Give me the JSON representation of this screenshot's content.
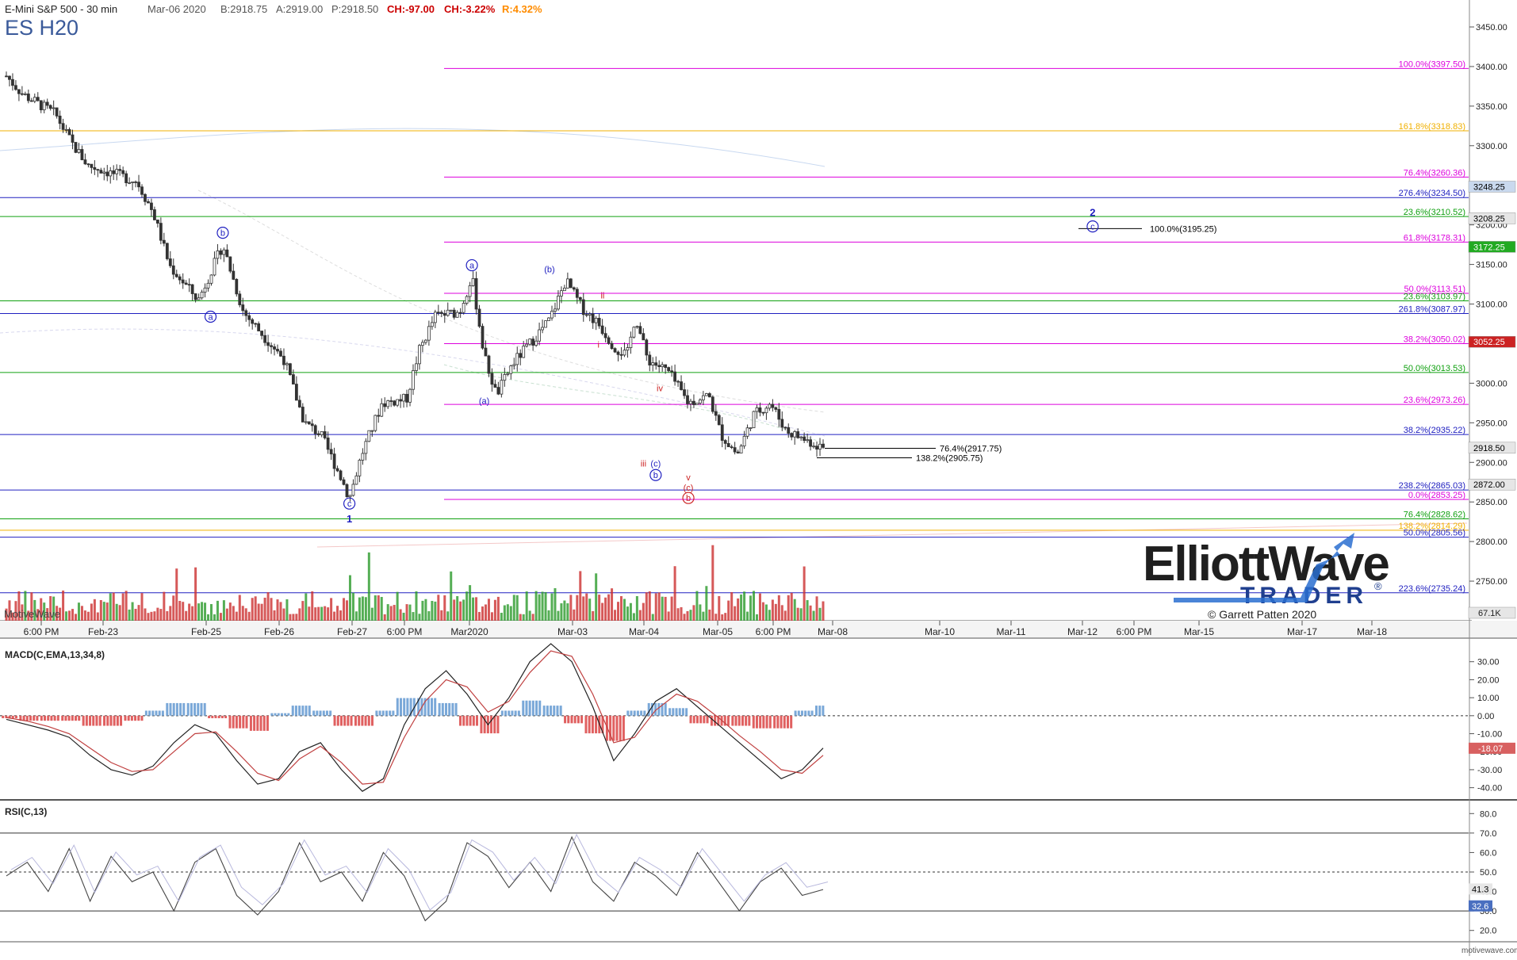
{
  "header": {
    "instrument": "E-Mini S&P 500 - 30 min",
    "date": "Mar-06 2020",
    "bid": "B:2918.75",
    "ask": "A:2919.00",
    "price": "P:2918.50",
    "change": "CH:-97.00",
    "change_pct": "CH:-3.22%",
    "range_pct": "R:4.32%",
    "symbol": "ES H20",
    "colors": {
      "negative": "#cc0000",
      "range": "#ff8c00",
      "symbol": "#3a5a9a"
    }
  },
  "chart_data": [
    {
      "type": "candlestick",
      "panel": "price",
      "ylim": [
        2700,
        3460
      ],
      "y_ticks": [
        "3450.00",
        "3400.00",
        "3350.00",
        "3300.00",
        "3250.00",
        "3200.00",
        "3150.00",
        "3100.00",
        "3050.00",
        "3000.00",
        "2950.00",
        "2900.00",
        "2850.00",
        "2800.00",
        "2750.00"
      ],
      "x_ticks": [
        "6:00 PM",
        "Feb-23",
        "Feb-25",
        "Feb-26",
        "Feb-27",
        "6:00 PM",
        "Mar2020",
        "Mar-03",
        "Mar-04",
        "Mar-05",
        "6:00 PM",
        "Mar-08",
        "Mar-10",
        "Mar-11",
        "Mar-12",
        "6:00 PM",
        "Mar-15",
        "Mar-17",
        "Mar-18"
      ],
      "price_path": [
        {
          "t": 0,
          "v": 3388
        },
        {
          "t": 0.02,
          "v": 3365
        },
        {
          "t": 0.06,
          "v": 3340
        },
        {
          "t": 0.08,
          "v": 3303
        },
        {
          "t": 0.1,
          "v": 3275
        },
        {
          "t": 0.13,
          "v": 3265
        },
        {
          "t": 0.16,
          "v": 3255
        },
        {
          "t": 0.18,
          "v": 3215
        },
        {
          "t": 0.2,
          "v": 3148
        },
        {
          "t": 0.235,
          "v": 3105
        },
        {
          "t": 0.25,
          "v": 3140
        },
        {
          "t": 0.265,
          "v": 3175
        },
        {
          "t": 0.29,
          "v": 3090
        },
        {
          "t": 0.315,
          "v": 3060
        },
        {
          "t": 0.34,
          "v": 3030
        },
        {
          "t": 0.365,
          "v": 2950
        },
        {
          "t": 0.385,
          "v": 2935
        },
        {
          "t": 0.41,
          "v": 2880
        },
        {
          "t": 0.42,
          "v": 2855
        },
        {
          "t": 0.435,
          "v": 2910
        },
        {
          "t": 0.46,
          "v": 2975
        },
        {
          "t": 0.49,
          "v": 2980
        },
        {
          "t": 0.505,
          "v": 3040
        },
        {
          "t": 0.525,
          "v": 3085
        },
        {
          "t": 0.555,
          "v": 3090
        },
        {
          "t": 0.57,
          "v": 3135
        },
        {
          "t": 0.585,
          "v": 3035
        },
        {
          "t": 0.6,
          "v": 2985
        },
        {
          "t": 0.62,
          "v": 3025
        },
        {
          "t": 0.645,
          "v": 3055
        },
        {
          "t": 0.665,
          "v": 3080
        },
        {
          "t": 0.685,
          "v": 3130
        },
        {
          "t": 0.705,
          "v": 3095
        },
        {
          "t": 0.725,
          "v": 3075
        },
        {
          "t": 0.745,
          "v": 3045
        },
        {
          "t": 0.76,
          "v": 3035
        },
        {
          "t": 0.77,
          "v": 3085
        },
        {
          "t": 0.785,
          "v": 3030
        },
        {
          "t": 0.81,
          "v": 3015
        },
        {
          "t": 0.835,
          "v": 2975
        },
        {
          "t": 0.86,
          "v": 2985
        },
        {
          "t": 0.875,
          "v": 2935
        },
        {
          "t": 0.895,
          "v": 2910
        },
        {
          "t": 0.915,
          "v": 2960
        },
        {
          "t": 0.935,
          "v": 2975
        },
        {
          "t": 0.955,
          "v": 2940
        },
        {
          "t": 0.975,
          "v": 2930
        },
        {
          "t": 1,
          "v": 2918.5
        }
      ],
      "fib_levels": [
        {
          "label": "100.0%(3397.50)",
          "value": 3397.5,
          "color": "#dd00dd"
        },
        {
          "label": "161.8%(3318.83)",
          "value": 3318.83,
          "color": "#f0b000"
        },
        {
          "label": "76.4%(3260.36)",
          "value": 3260.36,
          "color": "#dd00dd"
        },
        {
          "label": "276.4%(3234.50)",
          "value": 3234.5,
          "color": "#2020c0"
        },
        {
          "label": "23.6%(3210.52)",
          "value": 3210.52,
          "color": "#10a010"
        },
        {
          "label": "61.8%(3178.31)",
          "value": 3178.31,
          "color": "#dd00dd"
        },
        {
          "label": "50.0%(3113.51)",
          "value": 3113.51,
          "color": "#dd00dd"
        },
        {
          "label": "23.6%(3103.97)",
          "value": 3103.97,
          "color": "#10a010"
        },
        {
          "label": "261.8%(3087.97)",
          "value": 3087.97,
          "color": "#2020c0"
        },
        {
          "label": "38.2%(3050.02)",
          "value": 3050.02,
          "color": "#dd00dd"
        },
        {
          "label": "50.0%(3013.53)",
          "value": 3013.53,
          "color": "#10a010"
        },
        {
          "label": "23.6%(2973.26)",
          "value": 2973.26,
          "color": "#dd00dd"
        },
        {
          "label": "38.2%(2935.22)",
          "value": 2935.22,
          "color": "#2020c0"
        },
        {
          "label": "76.4%(2917.75)",
          "value": 2917.75,
          "color": "#000000"
        },
        {
          "label": "138.2%(2905.75)",
          "value": 2905.75,
          "color": "#000000"
        },
        {
          "label": "238.2%(2865.03)",
          "value": 2865.03,
          "color": "#2020c0"
        },
        {
          "label": "0.0%(2853.25)",
          "value": 2853.25,
          "color": "#dd00dd"
        },
        {
          "label": "76.4%(2828.62)",
          "value": 2828.62,
          "color": "#10a010"
        },
        {
          "label": "138.2%(2814.29)",
          "value": 2814.29,
          "color": "#f0b000"
        },
        {
          "label": "50.0%(2805.56)",
          "value": 2805.56,
          "color": "#2020c0"
        },
        {
          "label": "223.6%(2735.24)",
          "value": 2735.24,
          "color": "#2020c0"
        },
        {
          "label": "100.0%(3195.25)",
          "value": 3195.25,
          "color": "#000000"
        }
      ],
      "price_badges": [
        {
          "label": "3248.25",
          "value": 3248.25,
          "bg": "#c9d9ee",
          "fg": "#000000"
        },
        {
          "label": "3208.25",
          "value": 3208.25,
          "bg": "#e6e6e6",
          "fg": "#000000"
        },
        {
          "label": "3172.25",
          "value": 3172.25,
          "bg": "#22aa22",
          "fg": "#ffffff"
        },
        {
          "label": "3052.25",
          "value": 3052.25,
          "bg": "#cc2222",
          "fg": "#ffffff"
        },
        {
          "label": "2918.50",
          "value": 2918.5,
          "bg": "#e6e6e6",
          "fg": "#000000"
        },
        {
          "label": "2872.00",
          "value": 2872.0,
          "bg": "#e6e6e6",
          "fg": "#000000"
        }
      ],
      "wave_labels": [
        {
          "text": "b",
          "circled": true,
          "color": "#2020c0",
          "t": 0.265,
          "v": 3186
        },
        {
          "text": "a",
          "circled": true,
          "color": "#2020c0",
          "t": 0.25,
          "v": 3080
        },
        {
          "text": "c",
          "circled": true,
          "color": "#2020c0",
          "t": 0.42,
          "v": 2844
        },
        {
          "text": "1",
          "circled": false,
          "color": "#2020c0",
          "t": 0.42,
          "v": 2824
        },
        {
          "text": "a",
          "circled": true,
          "color": "#2020c0",
          "t": 0.57,
          "v": 3145
        },
        {
          "text": "(a)",
          "circled": false,
          "color": "#2020c0",
          "t": 0.585,
          "v": 2974
        },
        {
          "text": "(b)",
          "circled": false,
          "color": "#2020c0",
          "t": 0.665,
          "v": 3140
        },
        {
          "text": "ii",
          "circled": false,
          "color": "#cc2222",
          "t": 0.73,
          "v": 3107
        },
        {
          "text": "i",
          "circled": false,
          "color": "#cc2222",
          "t": 0.725,
          "v": 3045
        },
        {
          "text": "iv",
          "circled": false,
          "color": "#cc2222",
          "t": 0.8,
          "v": 2990
        },
        {
          "text": "iii",
          "circled": false,
          "color": "#cc2222",
          "t": 0.78,
          "v": 2895
        },
        {
          "text": "(c)",
          "circled": false,
          "color": "#2020c0",
          "t": 0.795,
          "v": 2895
        },
        {
          "text": "b",
          "circled": true,
          "color": "#2020c0",
          "t": 0.795,
          "v": 2880
        },
        {
          "text": "v",
          "circled": false,
          "color": "#cc2222",
          "t": 0.835,
          "v": 2877
        },
        {
          "text": "(c)",
          "circled": false,
          "color": "#cc2222",
          "t": 0.835,
          "v": 2864
        },
        {
          "text": "b",
          "circled": true,
          "color": "#cc2222",
          "t": 0.835,
          "v": 2851
        },
        {
          "text": "2",
          "circled": false,
          "color": "#2020c0",
          "t": 1.33,
          "v": 3211
        },
        {
          "text": "c",
          "circled": true,
          "color": "#2020c0",
          "t": 1.33,
          "v": 3194
        }
      ]
    },
    {
      "type": "line",
      "panel": "macd",
      "title": "MACD(C,EMA,13,34,8)",
      "ylim": [
        -45,
        40
      ],
      "y_ticks": [
        "30.00",
        "20.00",
        "10.00",
        "0.00",
        "-10.00",
        "-20.00",
        "-30.00",
        "-40.00"
      ],
      "last_value": "-18.07",
      "series": [
        {
          "role": "macd",
          "color": "#222222",
          "values": [
            -2,
            -5,
            -8,
            -12,
            -22,
            -30,
            -33,
            -28,
            -15,
            -5,
            -10,
            -25,
            -38,
            -35,
            -20,
            -15,
            -30,
            -42,
            -35,
            -5,
            15,
            25,
            12,
            -5,
            10,
            30,
            40,
            30,
            5,
            -25,
            -10,
            8,
            15,
            5,
            -5,
            -15,
            -25,
            -35,
            -30,
            -18
          ]
        },
        {
          "role": "signal",
          "color": "#c04040",
          "values": [
            -1,
            -3,
            -6,
            -10,
            -18,
            -26,
            -31,
            -30,
            -20,
            -10,
            -9,
            -20,
            -32,
            -36,
            -24,
            -17,
            -26,
            -38,
            -37,
            -12,
            8,
            20,
            16,
            2,
            8,
            24,
            36,
            33,
            12,
            -15,
            -12,
            3,
            12,
            8,
            -1,
            -11,
            -20,
            -30,
            -32,
            -22
          ]
        }
      ]
    },
    {
      "type": "line",
      "panel": "rsi",
      "title": "RSI(C,13)",
      "ylim": [
        15,
        85
      ],
      "y_ticks": [
        "80.0",
        "70.0",
        "60.0",
        "50.0",
        "40.0",
        "30.0",
        "20.0"
      ],
      "levels": [
        70,
        50,
        30
      ],
      "last_values": [
        "41.3",
        "32.6"
      ],
      "values": [
        48,
        55,
        40,
        62,
        35,
        58,
        45,
        50,
        30,
        55,
        62,
        38,
        28,
        40,
        65,
        45,
        50,
        35,
        60,
        48,
        25,
        35,
        65,
        58,
        42,
        55,
        40,
        68,
        45,
        35,
        55,
        48,
        38,
        60,
        45,
        30,
        45,
        52,
        38,
        41
      ]
    }
  ],
  "volume_badge": "67.1K",
  "logo": {
    "line1": "ElliottWave",
    "line2": "TRADER",
    "reg": "®",
    "copyright": "© Garrett Patten 2020"
  },
  "footer": {
    "brand": "motivewave.com"
  },
  "watermark": "MotiveWave",
  "colors": {
    "up": "#2a9a2a",
    "down": "#cc3030",
    "candle": "#333333"
  }
}
